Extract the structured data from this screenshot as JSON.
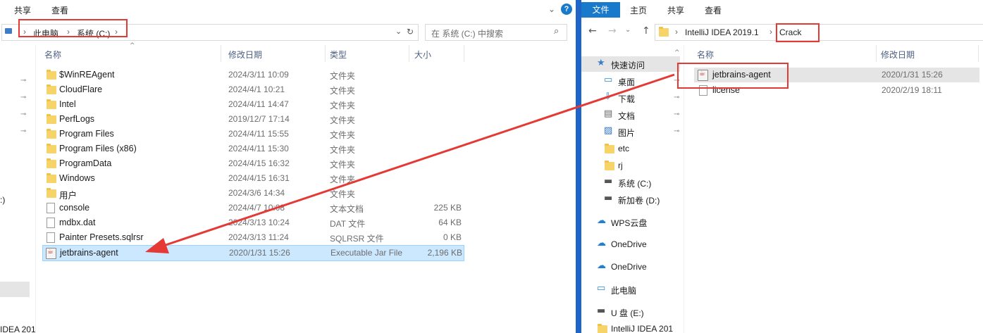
{
  "left": {
    "ribbon_tabs": [
      "共享",
      "查看"
    ],
    "address": {
      "crumbs": [
        "此电脑",
        "系统 (C:)"
      ]
    },
    "search_placeholder": "在 系统 (C:) 中搜索",
    "columns": {
      "name": "名称",
      "date": "修改日期",
      "type": "类型",
      "size": "大小"
    },
    "files": [
      {
        "name": "$WinREAgent",
        "date": "2024/3/11 10:09",
        "type": "文件夹",
        "size": "",
        "kind": "folder"
      },
      {
        "name": "CloudFlare",
        "date": "2024/4/1 10:21",
        "type": "文件夹",
        "size": "",
        "kind": "folder"
      },
      {
        "name": "Intel",
        "date": "2024/4/11 14:47",
        "type": "文件夹",
        "size": "",
        "kind": "folder"
      },
      {
        "name": "PerfLogs",
        "date": "2019/12/7 17:14",
        "type": "文件夹",
        "size": "",
        "kind": "folder"
      },
      {
        "name": "Program Files",
        "date": "2024/4/11 15:55",
        "type": "文件夹",
        "size": "",
        "kind": "folder"
      },
      {
        "name": "Program Files (x86)",
        "date": "2024/4/11 15:30",
        "type": "文件夹",
        "size": "",
        "kind": "folder"
      },
      {
        "name": "ProgramData",
        "date": "2024/4/15 16:32",
        "type": "文件夹",
        "size": "",
        "kind": "folder"
      },
      {
        "name": "Windows",
        "date": "2024/4/15 16:31",
        "type": "文件夹",
        "size": "",
        "kind": "folder"
      },
      {
        "name": "用户",
        "date": "2024/3/6 14:34",
        "type": "文件夹",
        "size": "",
        "kind": "folder"
      },
      {
        "name": "console",
        "date": "2024/4/7 10:08",
        "type": "文本文档",
        "size": "225 KB",
        "kind": "file"
      },
      {
        "name": "mdbx.dat",
        "date": "2024/3/13 10:24",
        "type": "DAT 文件",
        "size": "64 KB",
        "kind": "file"
      },
      {
        "name": "Painter Presets.sqlrsr",
        "date": "2024/3/13 11:24",
        "type": "SQLRSR 文件",
        "size": "0 KB",
        "kind": "file"
      },
      {
        "name": "jetbrains-agent",
        "date": "2020/1/31 15:26",
        "type": "Executable Jar File",
        "size": "2,196 KB",
        "kind": "jar"
      }
    ],
    "sidebar_fragments": [
      ":)",
      "IDEA 201"
    ]
  },
  "right": {
    "ribbon_tabs": [
      "文件",
      "主页",
      "共享",
      "查看"
    ],
    "address": {
      "crumbs": [
        "IntelliJ IDEA 2019.1",
        "Crack"
      ]
    },
    "columns": {
      "name": "名称",
      "date": "修改日期"
    },
    "files": [
      {
        "name": "jetbrains-agent",
        "date": "2020/1/31 15:26",
        "kind": "jar"
      },
      {
        "name": "license",
        "date": "2020/2/19 18:11",
        "kind": "file"
      }
    ],
    "nav": [
      {
        "label": "快速访问",
        "icon": "star-icon"
      },
      {
        "label": "桌面",
        "icon": "desktop-icon"
      },
      {
        "label": "下载",
        "icon": "download-icon"
      },
      {
        "label": "文档",
        "icon": "document-icon"
      },
      {
        "label": "图片",
        "icon": "picture-icon"
      },
      {
        "label": "etc",
        "icon": "folder-icon"
      },
      {
        "label": "rj",
        "icon": "folder-icon"
      },
      {
        "label": "系统 (C:)",
        "icon": "drive-icon"
      },
      {
        "label": "新加卷 (D:)",
        "icon": "drive-icon"
      },
      {
        "label": "WPS云盘",
        "icon": "cloud-icon"
      },
      {
        "label": "OneDrive",
        "icon": "cloud-icon"
      },
      {
        "label": "OneDrive",
        "icon": "cloud-icon"
      },
      {
        "label": "此电脑",
        "icon": "computer-icon"
      },
      {
        "label": "U 盘 (E:)",
        "icon": "usb-drive-icon"
      },
      {
        "label": "IntelliJ IDEA 201",
        "icon": "folder-icon"
      }
    ]
  },
  "colors": {
    "arrow": "#e53935",
    "highlight_box": "#e53935",
    "selection": "#cce8ff",
    "accent": "#1979ca"
  }
}
